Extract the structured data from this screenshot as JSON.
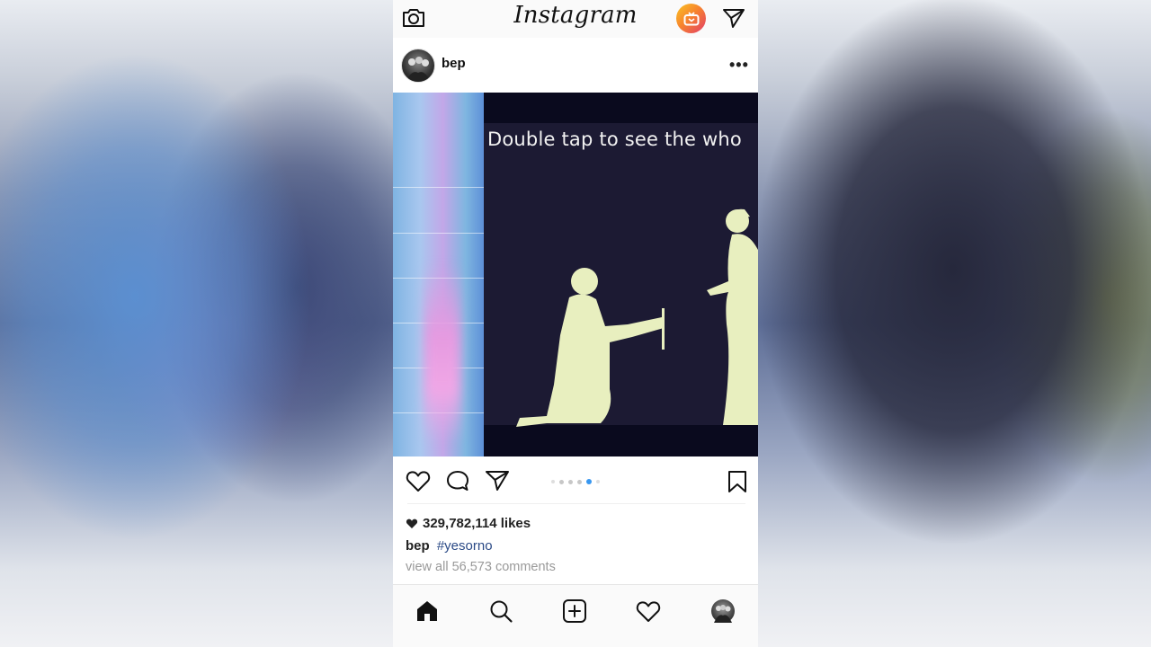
{
  "header": {
    "brand": "Instagram",
    "icons": [
      "camera-icon",
      "igtv-icon",
      "direct-send-icon"
    ]
  },
  "post": {
    "username": "bep",
    "menu_icon": "more-dots-icon",
    "image_overlay_text": "Double tap to see the who",
    "carousel": {
      "total": 6,
      "active_index": 4
    },
    "likes": "329,782,114 likes",
    "caption_user": "bep",
    "caption_tag": "#yesorno",
    "comments_link": "view all 56,573 comments",
    "actions": [
      "like-icon",
      "comment-icon",
      "share-icon",
      "bookmark-icon"
    ]
  },
  "bottom_nav": [
    "home-icon",
    "search-icon",
    "new-post-icon",
    "activity-heart-icon",
    "profile-avatar"
  ],
  "colors": {
    "accent_blue": "#3897f0",
    "hashtag": "#2b4a86",
    "muted_text": "#9a9a9a"
  }
}
